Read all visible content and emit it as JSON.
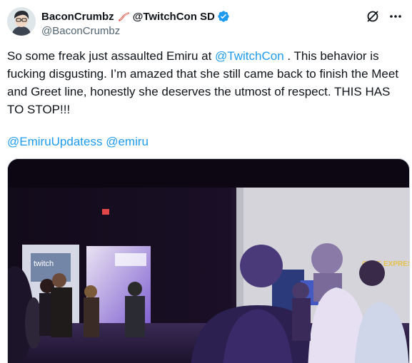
{
  "user": {
    "display_name": "BaconCrumbz",
    "name_suffix": "@TwitchCon SD",
    "handle": "@BaconCrumbz",
    "avatar_icon": "cartoon-avatar-icon",
    "emoji_icon": "bacon-icon",
    "verified_icon": "verified-badge-icon"
  },
  "actions": {
    "grok_icon": "grok-icon",
    "more_icon": "more-icon"
  },
  "post": {
    "text_1": "So some freak just assaulted Emiru at ",
    "mention_1": "@TwitchCon",
    "text_2": " . This behavior is fucking disgusting. I’m amazed that she still came back to finish the Meet and Greet line, honestly she deserves the utmost of respect. THIS HAS TO STOP!!!",
    "mention_2": "@EmiruUpdatess",
    "mention_3": "@emiru"
  },
  "media": {
    "sign_text": "CAFE EXPRESS",
    "booth_text": "twitch"
  },
  "colors": {
    "accent": "#1d9bf0",
    "text": "#0f1419",
    "secondary": "#536471",
    "verified": "#1d9bf0"
  }
}
